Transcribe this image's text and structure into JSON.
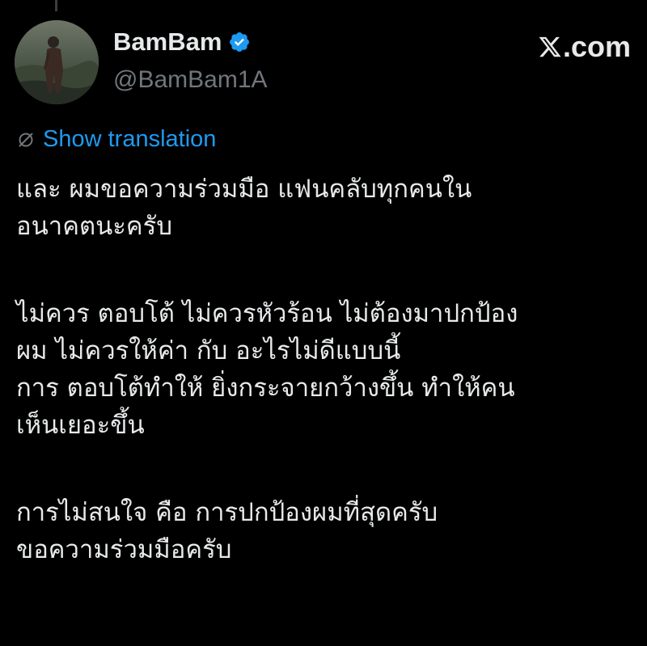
{
  "author": {
    "display_name": "BamBam",
    "handle": "@BamBam1A",
    "verified": true,
    "verified_color": "#1d9bf0",
    "avatar_icon": "profile-photo"
  },
  "brand": {
    "logo_text": ".com",
    "logo_icon": "x-logo-icon"
  },
  "translation": {
    "label": "Show translation",
    "icon": "globe-icon",
    "link_color": "#1d9bf0"
  },
  "tweet": {
    "paragraphs": [
      [
        "และ ผมขอความร่วมมือ แฟนคลับทุกคนใน",
        "อนาคตนะครับ"
      ],
      [
        "ไม่ควร ตอบโต้ ไม่ควรหัวร้อน ไม่ต้องมาปกป้อง",
        "ผม ไม่ควรให้ค่า กับ อะไรไม่ดีแบบนี้",
        "การ ตอบโต้ทำให้ ยิ่งกระจายกว้างขึ้น ทำให้คน",
        "เห็นเยอะขึ้น"
      ],
      [
        "การไม่สนใจ คือ การปกป้องผมที่สุดครับ",
        "ขอความร่วมมือครับ"
      ]
    ]
  }
}
